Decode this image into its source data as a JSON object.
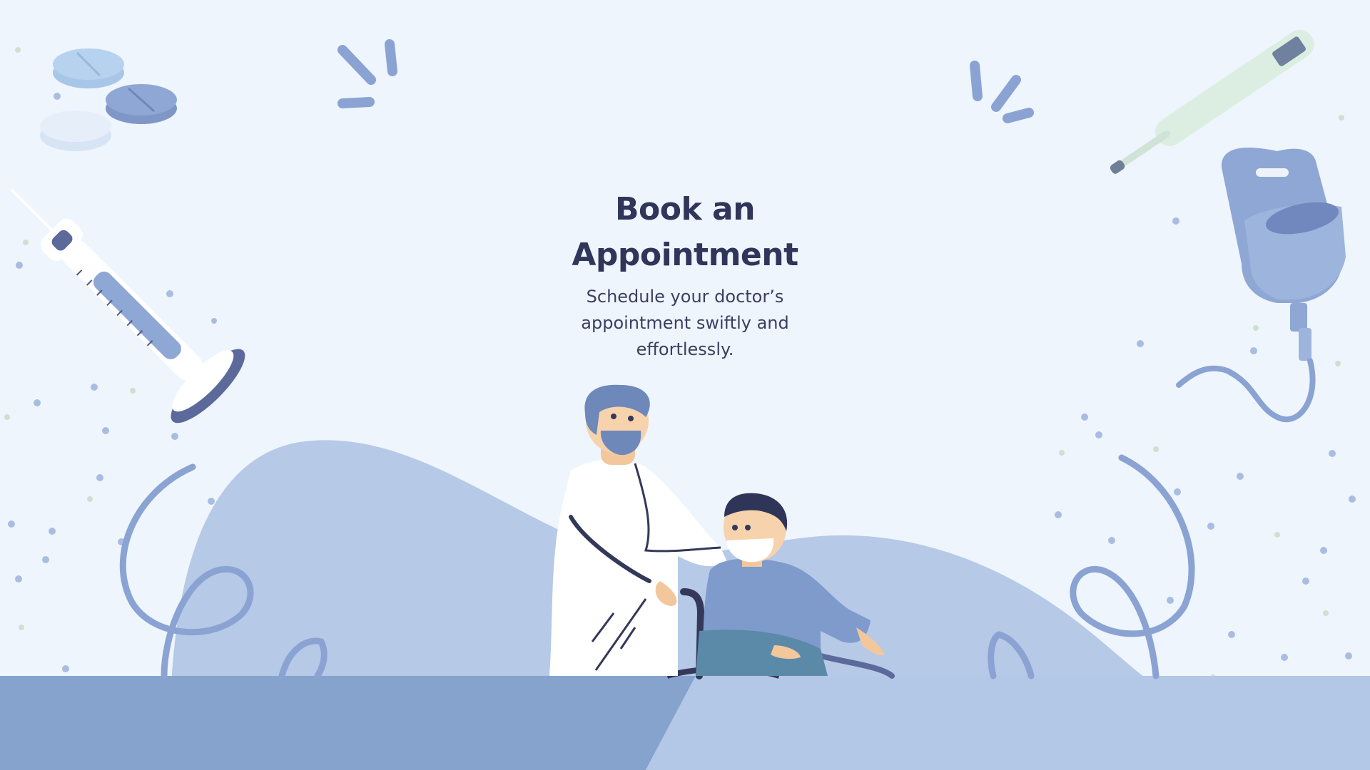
{
  "hero": {
    "title_line1": "Book an",
    "title_line2": "Appointment",
    "subtitle": "Schedule your doctor’s appointment swiftly and effortlessly."
  },
  "colors": {
    "background": "#eef5fd",
    "hill": "#b6c9e6",
    "floor_dark": "#86a3cd",
    "floor_light": "#b3c7e6",
    "accent": "#7f9bcc",
    "navy": "#4e5b8e",
    "title": "#30355a"
  },
  "illustrations": [
    "pills-icon",
    "syringe-icon",
    "thermometer-icon",
    "iv-bag-icon",
    "doctor-figure",
    "patient-in-wheelchair-figure",
    "star-confetti"
  ]
}
